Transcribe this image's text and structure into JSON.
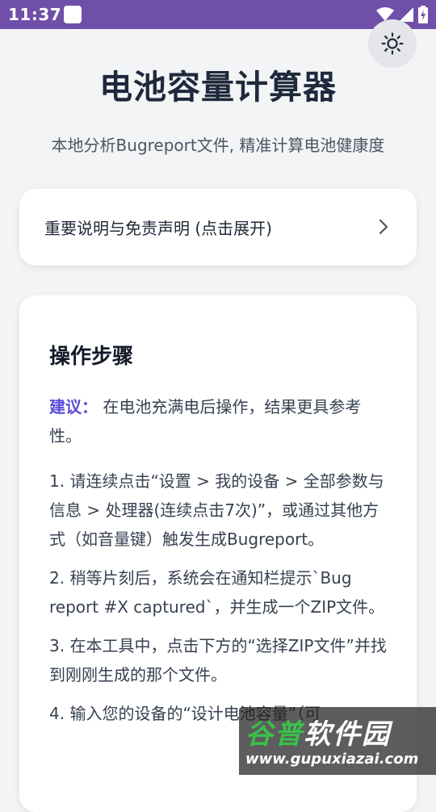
{
  "status_bar": {
    "time": "11:37"
  },
  "header": {
    "title": "电池容量计算器",
    "subtitle": "本地分析Bugreport文件, 精准计算电池健康度"
  },
  "disclaimer": {
    "label": "重要说明与免责声明 (点击展开)"
  },
  "steps": {
    "title": "操作步骤",
    "advice_label": "建议：",
    "advice_text": " 在电池充满电后操作，结果更具参考性。",
    "items": [
      "1. 请连续点击“设置 > 我的设备 > 全部参数与信息 > 处理器(连续点击7次)”，或通过其他方式（如音量键）触发生成Bugreport。",
      "2. 稍等片刻后，系统会在通知栏提示`Bug report #X captured`，并生成一个ZIP文件。",
      "3. 在本工具中，点击下方的“选择ZIP文件”并找到刚刚生成的那个文件。",
      "4. 输入您的设备的“设计电池容量”（可"
    ]
  },
  "watermark": {
    "title_part1": "谷普",
    "title_part2": "软件园",
    "url": "www.gupuxiazai.com"
  },
  "colors": {
    "status_bar": "#6f4fa8",
    "background": "#f3f4f6",
    "accent": "#5b4bd8"
  }
}
